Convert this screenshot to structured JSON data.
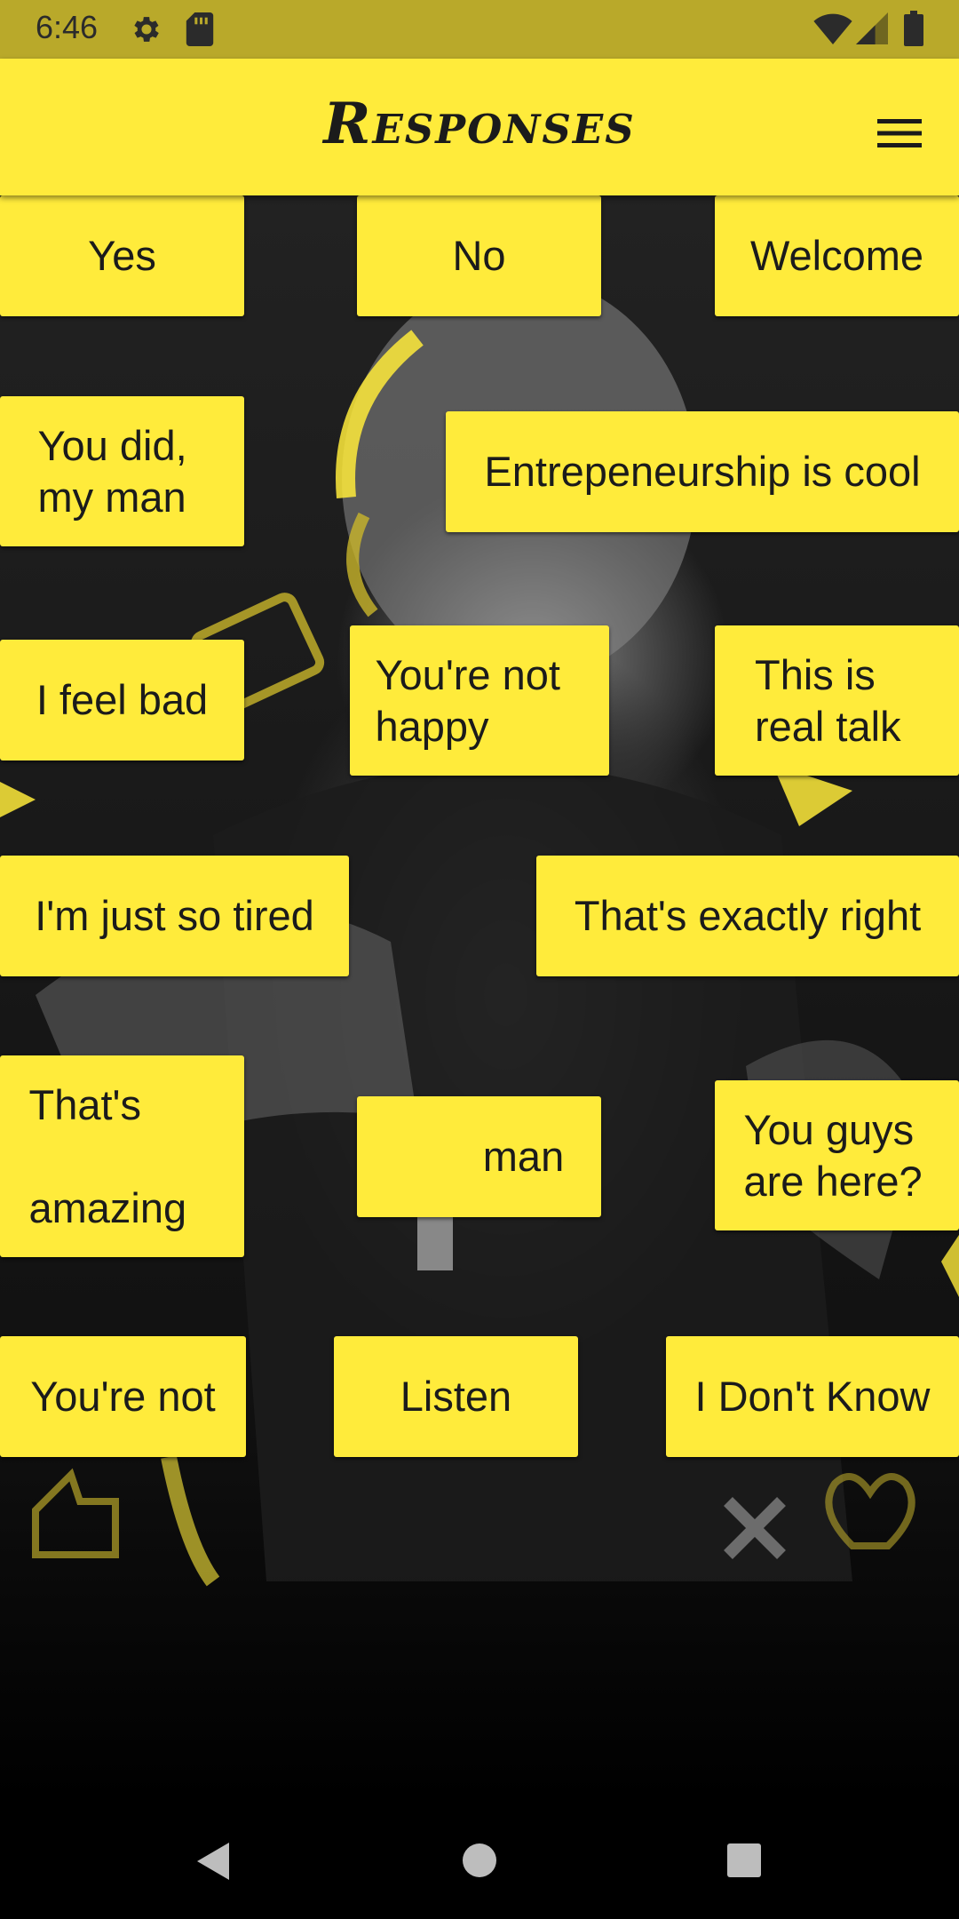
{
  "status_bar": {
    "time": "6:46",
    "icons": [
      "gear-icon",
      "sd-card-icon",
      "wifi-icon",
      "signal-icon",
      "battery-icon"
    ]
  },
  "toolbar": {
    "title": "Responses",
    "menu_icon": "hamburger-menu-icon"
  },
  "responses": [
    {
      "label": "Yes"
    },
    {
      "label": "No"
    },
    {
      "label": "Welcome"
    },
    {
      "label": "You did, my man"
    },
    {
      "label": "Entrepeneurship is cool"
    },
    {
      "label": "I feel bad"
    },
    {
      "label": "You're not happy"
    },
    {
      "label": "This is real talk"
    },
    {
      "label": "I'm just so tired"
    },
    {
      "label": "That's exactly right"
    },
    {
      "label": "That's amazing"
    },
    {
      "label": "man"
    },
    {
      "label": "You guys are here?"
    },
    {
      "label": "You're not"
    },
    {
      "label": "Listen"
    },
    {
      "label": "I Don't Know"
    }
  ],
  "navigation": {
    "icons": [
      "back-icon",
      "home-icon",
      "recents-icon"
    ]
  },
  "colors": {
    "accent": "#ffeb3b",
    "status_bar": "#b9a92a",
    "text": "#1b1b1b"
  }
}
